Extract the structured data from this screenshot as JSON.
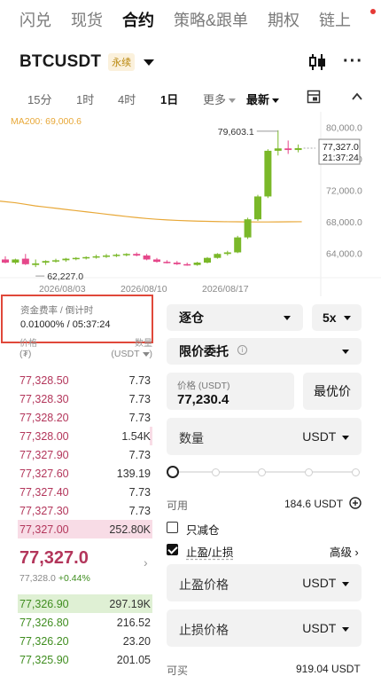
{
  "top_tabs": [
    "闪兑",
    "现货",
    "合约",
    "策略&跟单",
    "期权",
    "链上"
  ],
  "active_tab": "合约",
  "symbol": {
    "name": "BTCUSDT",
    "badge": "永续"
  },
  "intervals": {
    "m15": "15分",
    "h1": "1时",
    "h4": "4时",
    "d1": "1日",
    "more": "更多",
    "latest": "最新"
  },
  "chart_data": {
    "type": "candlestick",
    "indicator_label": "MA200: 69,000.6",
    "ylim": [
      61000,
      81500
    ],
    "y_ticks": [
      "80,000.0",
      "76,000.0",
      "72,000.0",
      "68,000.0",
      "64,000.0"
    ],
    "y_tick_values": [
      80000,
      76000,
      72000,
      68000,
      64000
    ],
    "x_ticks": [
      "2026/08/03",
      "2026/08/10",
      "2026/08/17"
    ],
    "high_marker": "79,603.1",
    "low_marker": "62,227.0",
    "last_price_tag": "77,327.0",
    "countdown_tag": "21:37:24",
    "candles": [
      {
        "o": 63200,
        "h": 63600,
        "l": 62700,
        "c": 62800
      },
      {
        "o": 62800,
        "h": 63300,
        "l": 62600,
        "c": 63200
      },
      {
        "o": 63300,
        "h": 63900,
        "l": 62500,
        "c": 62600
      },
      {
        "o": 62500,
        "h": 63200,
        "l": 62227,
        "c": 62700
      },
      {
        "o": 62800,
        "h": 63100,
        "l": 62500,
        "c": 63000
      },
      {
        "o": 63000,
        "h": 63300,
        "l": 62800,
        "c": 63100
      },
      {
        "o": 63100,
        "h": 63400,
        "l": 62900,
        "c": 63300
      },
      {
        "o": 63300,
        "h": 63500,
        "l": 63100,
        "c": 63400
      },
      {
        "o": 63400,
        "h": 63600,
        "l": 63200,
        "c": 63500
      },
      {
        "o": 63500,
        "h": 63800,
        "l": 63300,
        "c": 63600
      },
      {
        "o": 63600,
        "h": 63900,
        "l": 63400,
        "c": 63700
      },
      {
        "o": 63700,
        "h": 63950,
        "l": 63500,
        "c": 63800
      },
      {
        "o": 63800,
        "h": 64000,
        "l": 63600,
        "c": 63900
      },
      {
        "o": 63900,
        "h": 64100,
        "l": 63600,
        "c": 63700
      },
      {
        "o": 63700,
        "h": 63900,
        "l": 63100,
        "c": 63200
      },
      {
        "o": 63200,
        "h": 63400,
        "l": 62800,
        "c": 62900
      },
      {
        "o": 62900,
        "h": 63100,
        "l": 62700,
        "c": 62800
      },
      {
        "o": 62800,
        "h": 63000,
        "l": 62500,
        "c": 62600
      },
      {
        "o": 62600,
        "h": 62800,
        "l": 62400,
        "c": 62500
      },
      {
        "o": 62500,
        "h": 62900,
        "l": 62400,
        "c": 62800
      },
      {
        "o": 62800,
        "h": 63500,
        "l": 62700,
        "c": 63400
      },
      {
        "o": 63400,
        "h": 64000,
        "l": 63300,
        "c": 63900
      },
      {
        "o": 63900,
        "h": 64300,
        "l": 63700,
        "c": 64100
      },
      {
        "o": 64100,
        "h": 66200,
        "l": 64000,
        "c": 66000
      },
      {
        "o": 66000,
        "h": 68500,
        "l": 65800,
        "c": 68300
      },
      {
        "o": 68300,
        "h": 71400,
        "l": 68100,
        "c": 71200
      },
      {
        "o": 71200,
        "h": 77200,
        "l": 71000,
        "c": 77000
      },
      {
        "o": 77000,
        "h": 79603,
        "l": 76400,
        "c": 77300
      },
      {
        "o": 77300,
        "h": 78300,
        "l": 76600,
        "c": 77100
      },
      {
        "o": 77100,
        "h": 77800,
        "l": 76800,
        "c": 77327
      }
    ],
    "ma200": [
      70600,
      70400,
      70200,
      70000,
      69850,
      69700,
      69550,
      69400,
      69250,
      69100,
      68950,
      68800,
      68650,
      68520,
      68400,
      68300,
      68220,
      68160,
      68110,
      68070,
      68040,
      68010,
      67990,
      67980,
      67970,
      67960,
      67960,
      67970,
      67980,
      67990
    ]
  },
  "funding": {
    "label": "资金费率 / 倒计时",
    "value": "0.01000% / 05:37:24"
  },
  "orderbook": {
    "price_header": "价格",
    "qty_header": "数量",
    "price_unit": "(₮)",
    "qty_unit": "(USDT",
    "asks": [
      {
        "price": "77,328.50",
        "qty": "7.73",
        "depth": 0
      },
      {
        "price": "77,328.30",
        "qty": "7.73",
        "depth": 0
      },
      {
        "price": "77,328.20",
        "qty": "7.73",
        "depth": 0
      },
      {
        "price": "77,328.00",
        "qty": "1.54K",
        "depth": 0.02
      },
      {
        "price": "77,327.90",
        "qty": "7.73",
        "depth": 0
      },
      {
        "price": "77,327.60",
        "qty": "139.19",
        "depth": 0
      },
      {
        "price": "77,327.40",
        "qty": "7.73",
        "depth": 0
      },
      {
        "price": "77,327.30",
        "qty": "7.73",
        "depth": 0
      },
      {
        "price": "77,327.00",
        "qty": "252.80K",
        "depth": 1.0
      }
    ],
    "last_price": "77,327.0",
    "mark_price": "77,328.0",
    "change": "+0.44%",
    "bids": [
      {
        "price": "77,326.90",
        "qty": "297.19K",
        "depth": 1.0
      },
      {
        "price": "77,326.80",
        "qty": "216.52",
        "depth": 0
      },
      {
        "price": "77,326.20",
        "qty": "23.20",
        "depth": 0
      },
      {
        "price": "77,325.90",
        "qty": "201.05",
        "depth": 0
      }
    ]
  },
  "order_form": {
    "margin_mode": "逐仓",
    "leverage": "5x",
    "order_type": "限价委托",
    "price_label": "价格 (USDT)",
    "price_value": "77,230.4",
    "best_price_button": "最优价",
    "qty_label": "数量",
    "qty_unit": "USDT",
    "slider_percent": 0,
    "available_label": "可用",
    "available_value": "184.6 USDT",
    "reduce_only_label": "只减仓",
    "reduce_only_checked": false,
    "tpsl_label": "止盈/止损",
    "tpsl_checked": true,
    "advanced_label": "高级",
    "tp_label": "止盈价格",
    "tp_unit": "USDT",
    "sl_label": "止损价格",
    "sl_unit": "USDT",
    "can_buy_label": "可买",
    "can_buy_value": "919.04 USDT"
  },
  "colors": {
    "up": "#7ab829",
    "down": "#e5478a",
    "ma": "#e8a838",
    "highlight_border": "#e0483a"
  }
}
